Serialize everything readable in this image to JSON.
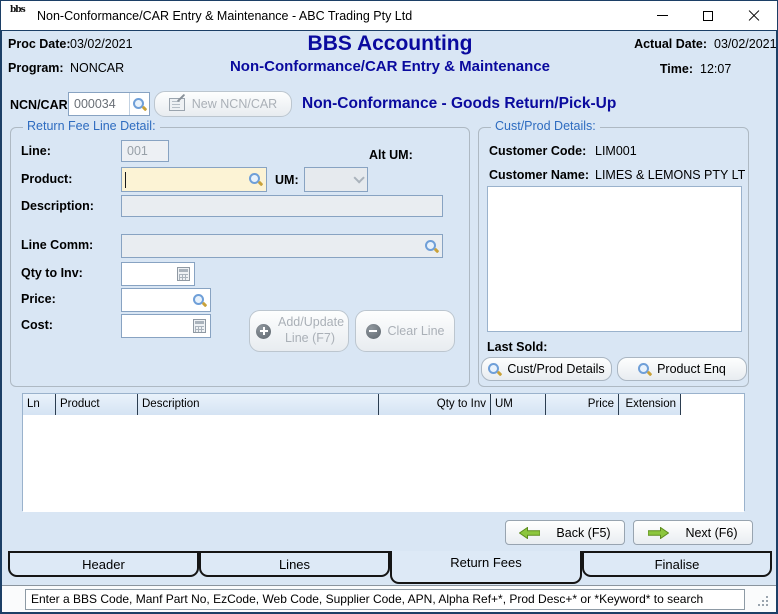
{
  "window": {
    "title": "Non-Conformance/CAR Entry & Maintenance - ABC Trading Pty Ltd",
    "app_icon_text": "bbs"
  },
  "header": {
    "proc_date_label": "Proc Date:",
    "proc_date": "03/02/2021",
    "program_label": "Program:",
    "program": "NONCAR",
    "app_title": "BBS Accounting",
    "screen_title": "Non-Conformance/CAR Entry & Maintenance",
    "actual_date_label": "Actual Date:",
    "actual_date": "03/02/2021",
    "time_label": "Time:",
    "time": "12:07"
  },
  "ncn_bar": {
    "label": "NCN/CAR:",
    "value": "000034",
    "new_button_label": "New NCN/CAR",
    "mode_title": "Non-Conformance - Goods Return/Pick-Up"
  },
  "return_fee": {
    "legend": "Return Fee Line Detail:",
    "line_label": "Line:",
    "line_value": "001",
    "alt_um_label": "Alt UM:",
    "product_label": "Product:",
    "product_value": "",
    "um_label": "UM:",
    "um_value": "",
    "description_label": "Description:",
    "description_value": "",
    "line_comm_label": "Line Comm:",
    "line_comm_value": "",
    "qty_label": "Qty to Inv:",
    "qty_value": "",
    "price_label": "Price:",
    "price_value": "",
    "cost_label": "Cost:",
    "cost_value": "",
    "add_update_button_label": "Add/Update Line (F7)",
    "clear_line_button_label": "Clear Line"
  },
  "cust_prod": {
    "legend": "Cust/Prod Details:",
    "customer_code_label": "Customer Code:",
    "customer_code": "LIM001",
    "customer_name_label": "Customer Name:",
    "customer_name": "LIMES & LEMONS PTY LTD",
    "details_text": "",
    "last_sold_label": "Last Sold:",
    "cust_prod_button_label": "Cust/Prod Details",
    "product_enq_button_label": "Product Enq"
  },
  "lines_table": {
    "columns": [
      "Ln",
      "Product",
      "Description",
      "Qty to Inv",
      "UM",
      "Price",
      "Extension"
    ],
    "rows": []
  },
  "nav": {
    "back_button_label": "Back (F5)",
    "next_button_label": "Next (F6)"
  },
  "tabs": [
    {
      "label": "Header",
      "active": false
    },
    {
      "label": "Lines",
      "active": false
    },
    {
      "label": "Return Fees",
      "active": true
    },
    {
      "label": "Finalise",
      "active": false
    }
  ],
  "status_bar": {
    "message": "Enter a BBS Code, Manf Part No, EzCode, Web Code, Supplier Code, APN, Alpha Ref+*, Prod Desc+* or *Keyword* to search"
  },
  "colors": {
    "accent_navy_text": "#0a0a9e",
    "legend_blue": "#2e6cc0",
    "window_border": "#1c3f66",
    "content_bg": "#d9e6f4",
    "product_field_bg": "#fcf3d5",
    "arrow_green": "#8cc63e",
    "grid_header_bg": "#dce9f7"
  }
}
